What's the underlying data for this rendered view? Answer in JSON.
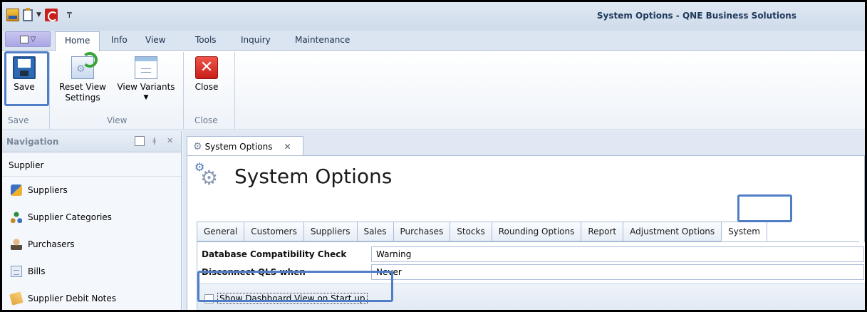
{
  "window": {
    "title": "System Options - QNE Business Solutions"
  },
  "ribbon": {
    "tabs": [
      "Home",
      "Info",
      "View",
      "Tools",
      "Inquiry",
      "Maintenance"
    ],
    "active_tab": "Home",
    "save_label": "Save",
    "reset_label_line1": "Reset View",
    "reset_label_line2": "Settings",
    "variants_label": "View Variants",
    "close_label": "Close",
    "groups": {
      "save": "Save",
      "view": "View",
      "close": "Close"
    }
  },
  "navigation": {
    "title": "Navigation",
    "section": "Supplier",
    "items": [
      {
        "label": "Suppliers",
        "icon": "suppliers-icon"
      },
      {
        "label": "Supplier Categories",
        "icon": "categories-icon"
      },
      {
        "label": "Purchasers",
        "icon": "purchaser-icon"
      },
      {
        "label": "Bills",
        "icon": "bill-icon"
      },
      {
        "label": "Supplier Debit Notes",
        "icon": "debit-note-icon"
      }
    ]
  },
  "document": {
    "tab_label": "System Options",
    "page_title": "System Options",
    "option_tabs": [
      "General",
      "Customers",
      "Suppliers",
      "Sales",
      "Purchases",
      "Stocks",
      "Rounding Options",
      "Report",
      "Adjustment Options",
      "System"
    ],
    "active_option_tab": "System",
    "fields": [
      {
        "label": "Database Compatibility Check",
        "value": "Warning"
      },
      {
        "label": "Disconnect QLS when",
        "value": "Never"
      }
    ],
    "checkbox": {
      "label": "Show Dashboard View on Start up",
      "checked": false
    }
  },
  "colors": {
    "highlight": "#4f7ec7",
    "ribbon_bg": "#dbe5f1",
    "close_red": "#c81f17"
  }
}
